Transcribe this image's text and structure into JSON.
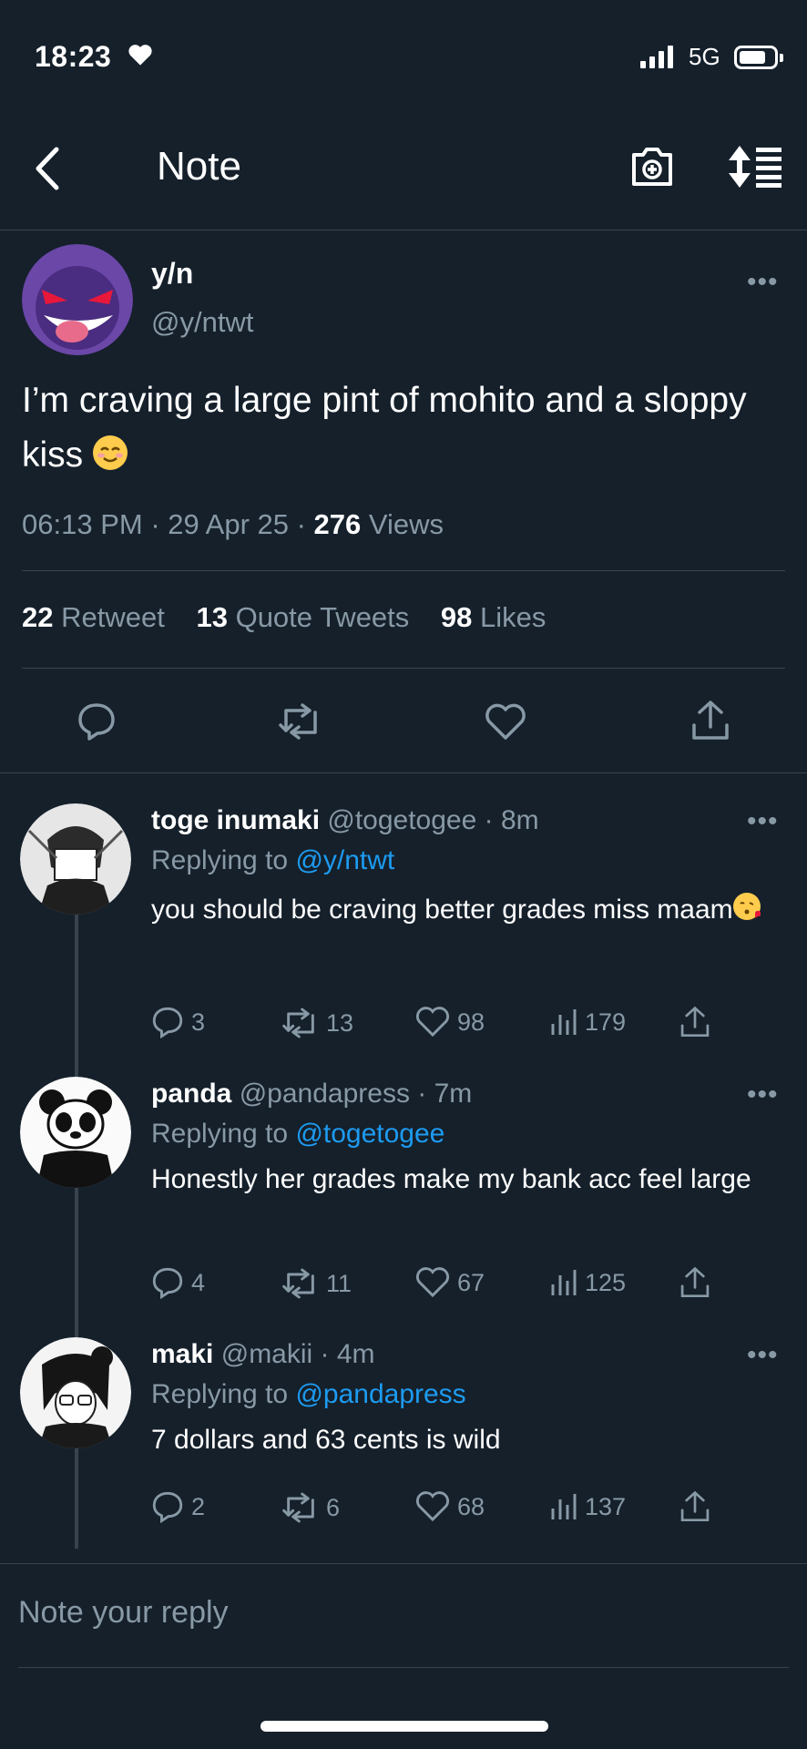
{
  "status": {
    "time": "18:23",
    "network": "5G"
  },
  "header": {
    "title": "Note"
  },
  "main_tweet": {
    "display_name": "y/n",
    "handle": "@y/ntwt",
    "text": "I’m craving a large pint of mohito and a sloppy kiss",
    "emoji": "smiling-face-with-blush",
    "time": "06:13 PM",
    "date": "29 Apr 25",
    "views_count": "276",
    "views_label": "Views",
    "retweets_count": "22",
    "retweets_label": "Retweet",
    "quotes_count": "13",
    "quotes_label": "Quote Tweets",
    "likes_count": "98",
    "likes_label": "Likes"
  },
  "replies": [
    {
      "display_name": "toge inumaki",
      "handle": "@togetogee",
      "age": "· 8m",
      "replying_prefix": "Replying to",
      "replying_to": "@y/ntwt",
      "text": "you should be craving better grades miss maam",
      "emoji": "face-blowing-a-kiss",
      "replies": "3",
      "retweets": "13",
      "likes": "98",
      "views": "179"
    },
    {
      "display_name": "panda",
      "handle": "@pandapress",
      "age": "· 7m",
      "replying_prefix": "Replying to",
      "replying_to": "@togetogee",
      "text": "Honestly her grades make my bank acc feel large",
      "replies": "4",
      "retweets": "11",
      "likes": "67",
      "views": "125"
    },
    {
      "display_name": "maki",
      "handle": "@makii",
      "age": "· 4m",
      "replying_prefix": "Replying to",
      "replying_to": "@pandapress",
      "text": "7 dollars and 63 cents is wild",
      "replies": "2",
      "retweets": "6",
      "likes": "68",
      "views": "137"
    }
  ],
  "composer": {
    "placeholder": "Note your reply"
  },
  "colors": {
    "background": "#15202b",
    "accent": "#1d9bf0",
    "muted": "#8899a6",
    "divider": "#38444d"
  }
}
